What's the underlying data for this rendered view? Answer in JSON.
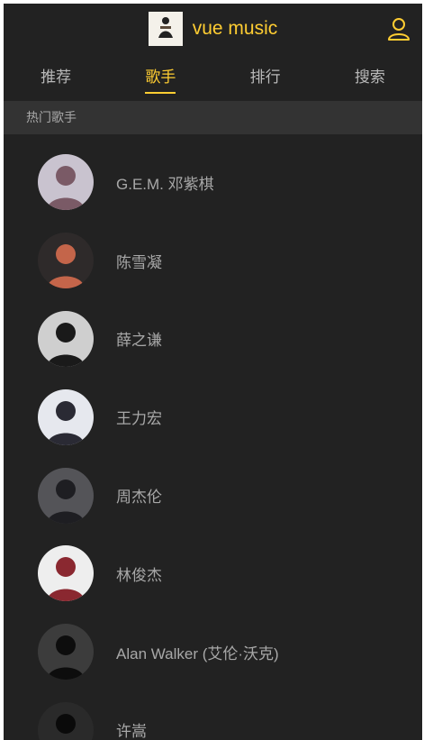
{
  "header": {
    "title": "vue music",
    "logo_icon": "vue-music-logo",
    "user_icon": "user-icon",
    "accent_color": "#ffcd32"
  },
  "tabs": [
    {
      "label": "推荐",
      "active": false
    },
    {
      "label": "歌手",
      "active": true
    },
    {
      "label": "排行",
      "active": false
    },
    {
      "label": "搜索",
      "active": false
    }
  ],
  "group": {
    "title": "热门歌手"
  },
  "singers": [
    {
      "name": "G.E.M. 邓紫棋",
      "avatar_bg": "#c9c3cf",
      "avatar_fg": "#7a5a66"
    },
    {
      "name": "陈雪凝",
      "avatar_bg": "#2e2a2a",
      "avatar_fg": "#c4654a"
    },
    {
      "name": "薛之谦",
      "avatar_bg": "#cfcfcf",
      "avatar_fg": "#1a1a1a"
    },
    {
      "name": "王力宏",
      "avatar_bg": "#e6e8ee",
      "avatar_fg": "#2a2a34"
    },
    {
      "name": "周杰伦",
      "avatar_bg": "#545458",
      "avatar_fg": "#1e1e22"
    },
    {
      "name": "林俊杰",
      "avatar_bg": "#eeeeee",
      "avatar_fg": "#8a2830"
    },
    {
      "name": "Alan Walker (艾伦·沃克)",
      "avatar_bg": "#3c3c3c",
      "avatar_fg": "#0d0d0d"
    },
    {
      "name": "许嵩",
      "avatar_bg": "#2a2a2a",
      "avatar_fg": "#0a0a0a"
    }
  ]
}
